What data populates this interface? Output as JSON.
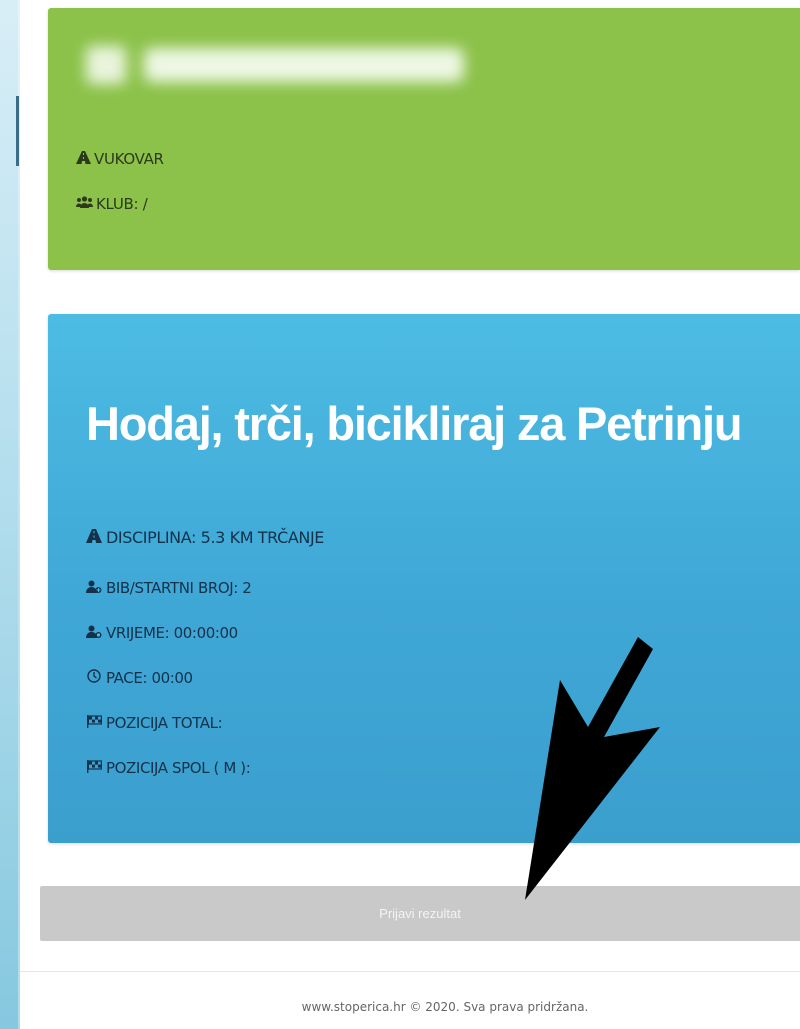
{
  "profile": {
    "city": "VUKOVAR",
    "club": "KLUB: /",
    "city_icon": "road-icon",
    "club_icon": "users-icon"
  },
  "event": {
    "title": "Hodaj, trči, bicikliraj za Petrinju",
    "discipline": "DISCIPLINA: 5.3 KM TRČANJE",
    "bib": "BIB/STARTNI BROJ: 2",
    "time": "VRIJEME: 00:00:00",
    "pace": "PACE: 00:00",
    "position_total": "POZICIJA TOTAL:",
    "position_gender": "POZICIJA SPOL ( M ):"
  },
  "actions": {
    "report_label": "Prijavi rezultat"
  },
  "footer": {
    "text": "www.stoperica.hr © 2020. Sva prava pridržana."
  },
  "colors": {
    "profile_card": "#8cc24a",
    "event_card": "#45b1dd",
    "button": "#c9c9c9"
  }
}
